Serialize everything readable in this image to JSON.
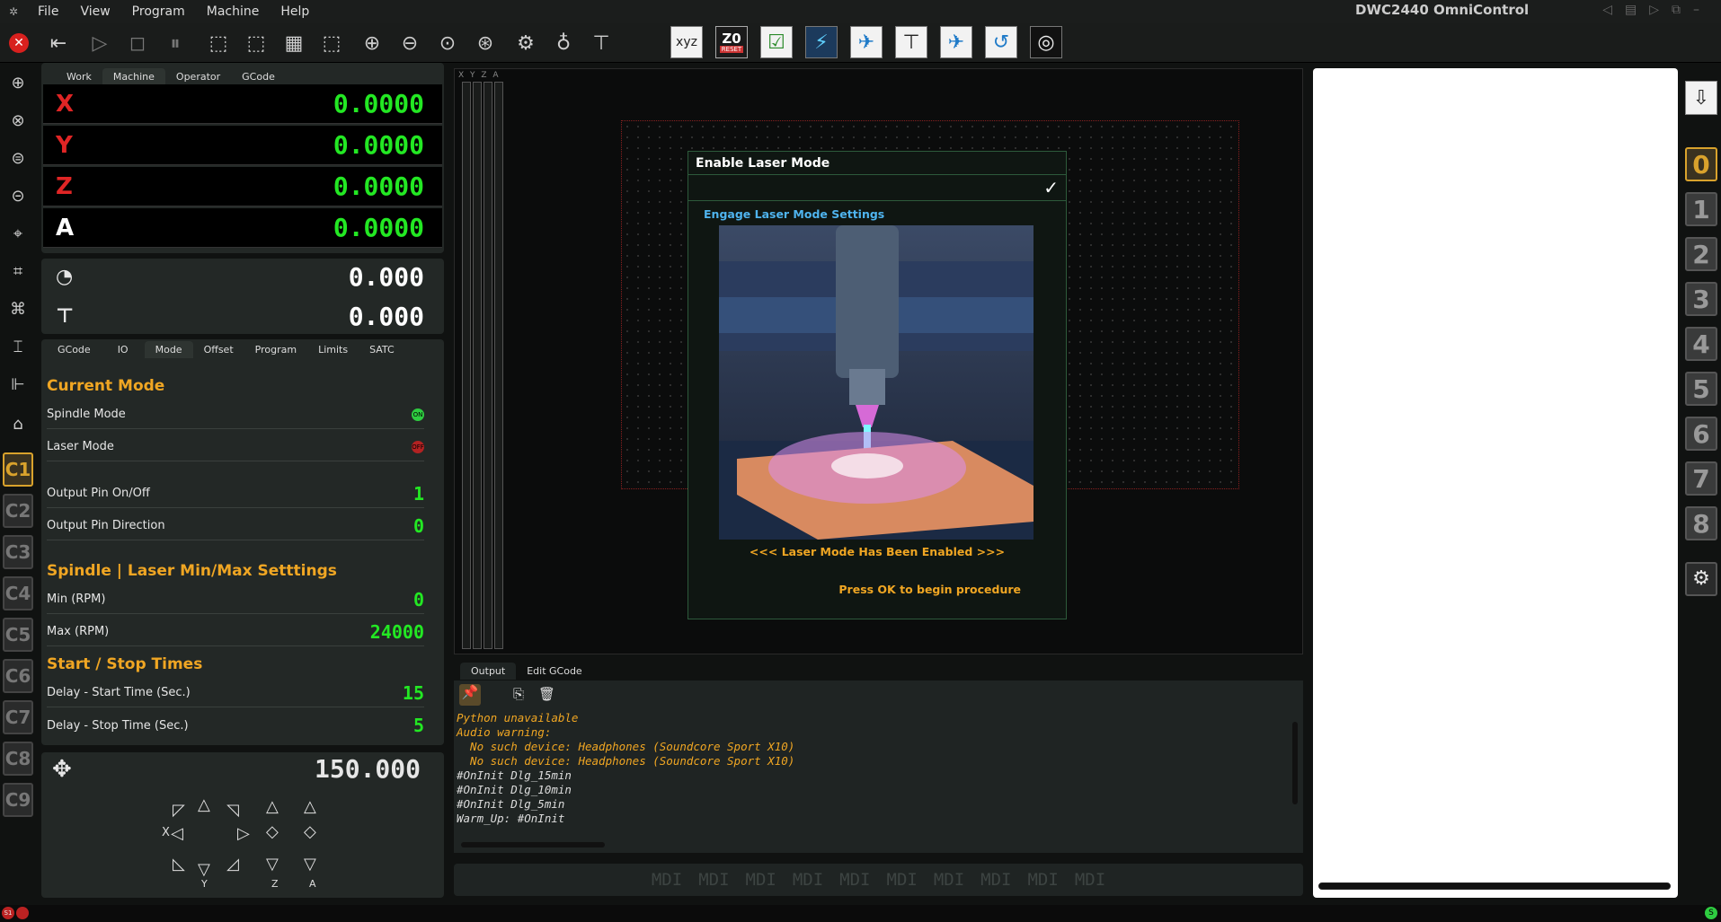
{
  "window": {
    "title": "DWC2440 OmniControl"
  },
  "menu": [
    "File",
    "View",
    "Program",
    "Machine",
    "Help"
  ],
  "toolbar": {
    "icons": [
      "stop-icon",
      "exit-icon",
      "play-icon",
      "stop-square-icon",
      "pause-icon",
      "view-iso-icon",
      "view-front-icon",
      "view-top-icon",
      "view-side-icon",
      "zoom-in-icon",
      "zoom-out-icon",
      "zoom-fit-icon",
      "zoom-extents-icon",
      "tool-change-icon",
      "probe-icon",
      "spindle-icon",
      "zero-xyz-icon",
      "z0-reset-icon",
      "check-icon",
      "laser-icon",
      "nav-icon",
      "tool-table-icon",
      "home-icon",
      "reset-icon",
      "settings-icon"
    ],
    "z0_label": "Z0",
    "reset_label": "RESET"
  },
  "dro": {
    "tabs": [
      "Work",
      "Machine",
      "Operator",
      "GCode"
    ],
    "active_tab": "Machine",
    "axes": [
      {
        "name": "X",
        "value": "0.0000",
        "color": "#e02525"
      },
      {
        "name": "Y",
        "value": "0.0000",
        "color": "#e02525"
      },
      {
        "name": "Z",
        "value": "0.0000",
        "color": "#e02525"
      },
      {
        "name": "A",
        "value": "0.0000",
        "color": "#ffffff"
      }
    ],
    "feed": "0.000",
    "spindle": "0.000"
  },
  "mode": {
    "tabs": [
      "GCode",
      "IO",
      "Mode",
      "Offset",
      "Program",
      "Limits",
      "SATC"
    ],
    "active_tab": "Mode",
    "current_mode_title": "Current Mode",
    "spindle_mode_label": "Spindle Mode",
    "spindle_led": "ON",
    "laser_mode_label": "Laser Mode",
    "laser_led": "OFF",
    "pin_onoff_label": "Output Pin On/Off",
    "pin_onoff": "1",
    "pin_dir_label": "Output Pin Direction",
    "pin_dir": "0",
    "minmax_title": "Spindle | Laser Min/Max Setttings",
    "min_label": "Min (RPM)",
    "min": "0",
    "max_label": "Max (RPM)",
    "max": "24000",
    "times_title": "Start / Stop Times",
    "start_label": "Delay - Start Time (Sec.)",
    "start": "15",
    "stop_label": "Delay - Stop Time (Sec.)",
    "stop": "5"
  },
  "jog": {
    "step": "150.000",
    "labels": {
      "x": "X",
      "y": "Y",
      "z": "Z",
      "a": "A"
    }
  },
  "axis_strip": "X Y Z A",
  "dialog": {
    "title": "Enable Laser Mode",
    "heading": "Engage Laser Mode Settings",
    "enabled": "<<< Laser Mode Has Been Enabled >>>",
    "prompt": "Press OK to begin procedure"
  },
  "output": {
    "tabs": [
      "Output",
      "Edit GCode"
    ],
    "active_tab": "Output",
    "lines": [
      {
        "text": "Python unavailable",
        "color": "#f0a623"
      },
      {
        "text": "Audio warning:",
        "color": "#f0a623"
      },
      {
        "text": "  No such device: Headphones (Soundcore Sport X10)",
        "color": "#f0a623"
      },
      {
        "text": "  No such device: Headphones (Soundcore Sport X10)",
        "color": "#f0a623"
      },
      {
        "text": "#OnInit Dlg_15min",
        "color": "#dddddd"
      },
      {
        "text": "#OnInit Dlg_10min",
        "color": "#dddddd"
      },
      {
        "text": "#OnInit Dlg_5min",
        "color": "#dddddd"
      },
      {
        "text": "Warm_Up: #OnInit",
        "color": "#dddddd"
      }
    ]
  },
  "mdi": [
    "MDI",
    "MDI",
    "MDI",
    "MDI",
    "MDI",
    "MDI",
    "MDI",
    "MDI",
    "MDI",
    "MDI"
  ],
  "custom_buttons": [
    "C1",
    "C2",
    "C3",
    "C4",
    "C5",
    "C6",
    "C7",
    "C8",
    "C9"
  ],
  "active_custom": "C1",
  "slots": [
    "0",
    "1",
    "2",
    "3",
    "4",
    "5",
    "6",
    "7",
    "8"
  ],
  "active_slot": "0",
  "status": {
    "left": "S1",
    "right": "S"
  }
}
